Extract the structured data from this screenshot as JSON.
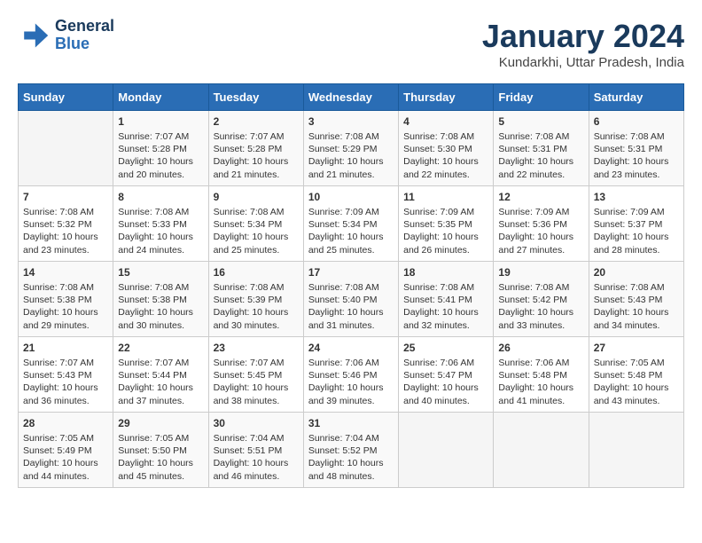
{
  "logo": {
    "line1": "General",
    "line2": "Blue"
  },
  "title": "January 2024",
  "subtitle": "Kundarkhi, Uttar Pradesh, India",
  "days_of_week": [
    "Sunday",
    "Monday",
    "Tuesday",
    "Wednesday",
    "Thursday",
    "Friday",
    "Saturday"
  ],
  "weeks": [
    [
      {
        "num": "",
        "text": ""
      },
      {
        "num": "1",
        "text": "Sunrise: 7:07 AM\nSunset: 5:28 PM\nDaylight: 10 hours\nand 20 minutes."
      },
      {
        "num": "2",
        "text": "Sunrise: 7:07 AM\nSunset: 5:28 PM\nDaylight: 10 hours\nand 21 minutes."
      },
      {
        "num": "3",
        "text": "Sunrise: 7:08 AM\nSunset: 5:29 PM\nDaylight: 10 hours\nand 21 minutes."
      },
      {
        "num": "4",
        "text": "Sunrise: 7:08 AM\nSunset: 5:30 PM\nDaylight: 10 hours\nand 22 minutes."
      },
      {
        "num": "5",
        "text": "Sunrise: 7:08 AM\nSunset: 5:31 PM\nDaylight: 10 hours\nand 22 minutes."
      },
      {
        "num": "6",
        "text": "Sunrise: 7:08 AM\nSunset: 5:31 PM\nDaylight: 10 hours\nand 23 minutes."
      }
    ],
    [
      {
        "num": "7",
        "text": "Sunrise: 7:08 AM\nSunset: 5:32 PM\nDaylight: 10 hours\nand 23 minutes."
      },
      {
        "num": "8",
        "text": "Sunrise: 7:08 AM\nSunset: 5:33 PM\nDaylight: 10 hours\nand 24 minutes."
      },
      {
        "num": "9",
        "text": "Sunrise: 7:08 AM\nSunset: 5:34 PM\nDaylight: 10 hours\nand 25 minutes."
      },
      {
        "num": "10",
        "text": "Sunrise: 7:09 AM\nSunset: 5:34 PM\nDaylight: 10 hours\nand 25 minutes."
      },
      {
        "num": "11",
        "text": "Sunrise: 7:09 AM\nSunset: 5:35 PM\nDaylight: 10 hours\nand 26 minutes."
      },
      {
        "num": "12",
        "text": "Sunrise: 7:09 AM\nSunset: 5:36 PM\nDaylight: 10 hours\nand 27 minutes."
      },
      {
        "num": "13",
        "text": "Sunrise: 7:09 AM\nSunset: 5:37 PM\nDaylight: 10 hours\nand 28 minutes."
      }
    ],
    [
      {
        "num": "14",
        "text": "Sunrise: 7:08 AM\nSunset: 5:38 PM\nDaylight: 10 hours\nand 29 minutes."
      },
      {
        "num": "15",
        "text": "Sunrise: 7:08 AM\nSunset: 5:38 PM\nDaylight: 10 hours\nand 30 minutes."
      },
      {
        "num": "16",
        "text": "Sunrise: 7:08 AM\nSunset: 5:39 PM\nDaylight: 10 hours\nand 30 minutes."
      },
      {
        "num": "17",
        "text": "Sunrise: 7:08 AM\nSunset: 5:40 PM\nDaylight: 10 hours\nand 31 minutes."
      },
      {
        "num": "18",
        "text": "Sunrise: 7:08 AM\nSunset: 5:41 PM\nDaylight: 10 hours\nand 32 minutes."
      },
      {
        "num": "19",
        "text": "Sunrise: 7:08 AM\nSunset: 5:42 PM\nDaylight: 10 hours\nand 33 minutes."
      },
      {
        "num": "20",
        "text": "Sunrise: 7:08 AM\nSunset: 5:43 PM\nDaylight: 10 hours\nand 34 minutes."
      }
    ],
    [
      {
        "num": "21",
        "text": "Sunrise: 7:07 AM\nSunset: 5:43 PM\nDaylight: 10 hours\nand 36 minutes."
      },
      {
        "num": "22",
        "text": "Sunrise: 7:07 AM\nSunset: 5:44 PM\nDaylight: 10 hours\nand 37 minutes."
      },
      {
        "num": "23",
        "text": "Sunrise: 7:07 AM\nSunset: 5:45 PM\nDaylight: 10 hours\nand 38 minutes."
      },
      {
        "num": "24",
        "text": "Sunrise: 7:06 AM\nSunset: 5:46 PM\nDaylight: 10 hours\nand 39 minutes."
      },
      {
        "num": "25",
        "text": "Sunrise: 7:06 AM\nSunset: 5:47 PM\nDaylight: 10 hours\nand 40 minutes."
      },
      {
        "num": "26",
        "text": "Sunrise: 7:06 AM\nSunset: 5:48 PM\nDaylight: 10 hours\nand 41 minutes."
      },
      {
        "num": "27",
        "text": "Sunrise: 7:05 AM\nSunset: 5:48 PM\nDaylight: 10 hours\nand 43 minutes."
      }
    ],
    [
      {
        "num": "28",
        "text": "Sunrise: 7:05 AM\nSunset: 5:49 PM\nDaylight: 10 hours\nand 44 minutes."
      },
      {
        "num": "29",
        "text": "Sunrise: 7:05 AM\nSunset: 5:50 PM\nDaylight: 10 hours\nand 45 minutes."
      },
      {
        "num": "30",
        "text": "Sunrise: 7:04 AM\nSunset: 5:51 PM\nDaylight: 10 hours\nand 46 minutes."
      },
      {
        "num": "31",
        "text": "Sunrise: 7:04 AM\nSunset: 5:52 PM\nDaylight: 10 hours\nand 48 minutes."
      },
      {
        "num": "",
        "text": ""
      },
      {
        "num": "",
        "text": ""
      },
      {
        "num": "",
        "text": ""
      }
    ]
  ]
}
